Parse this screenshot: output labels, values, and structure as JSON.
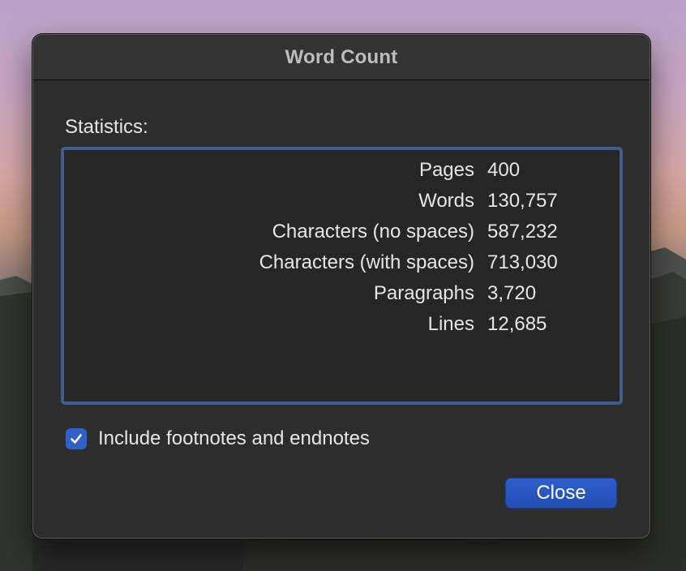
{
  "dialog": {
    "title": "Word Count",
    "statistics_label": "Statistics:",
    "statistics": [
      {
        "name": "Pages",
        "value": "400"
      },
      {
        "name": "Words",
        "value": "130,757"
      },
      {
        "name": "Characters (no spaces)",
        "value": "587,232"
      },
      {
        "name": "Characters (with spaces)",
        "value": "713,030"
      },
      {
        "name": "Paragraphs",
        "value": "3,720"
      },
      {
        "name": "Lines",
        "value": "12,685"
      }
    ],
    "include_footnotes": {
      "label": "Include footnotes and endnotes",
      "checked": true
    },
    "close_label": "Close"
  },
  "colors": {
    "accent": "#2f62c9",
    "stats_border": "#3f5f93",
    "dialog_bg": "#2d2d2d"
  },
  "icons": {
    "checkbox": "checkmark-icon"
  }
}
